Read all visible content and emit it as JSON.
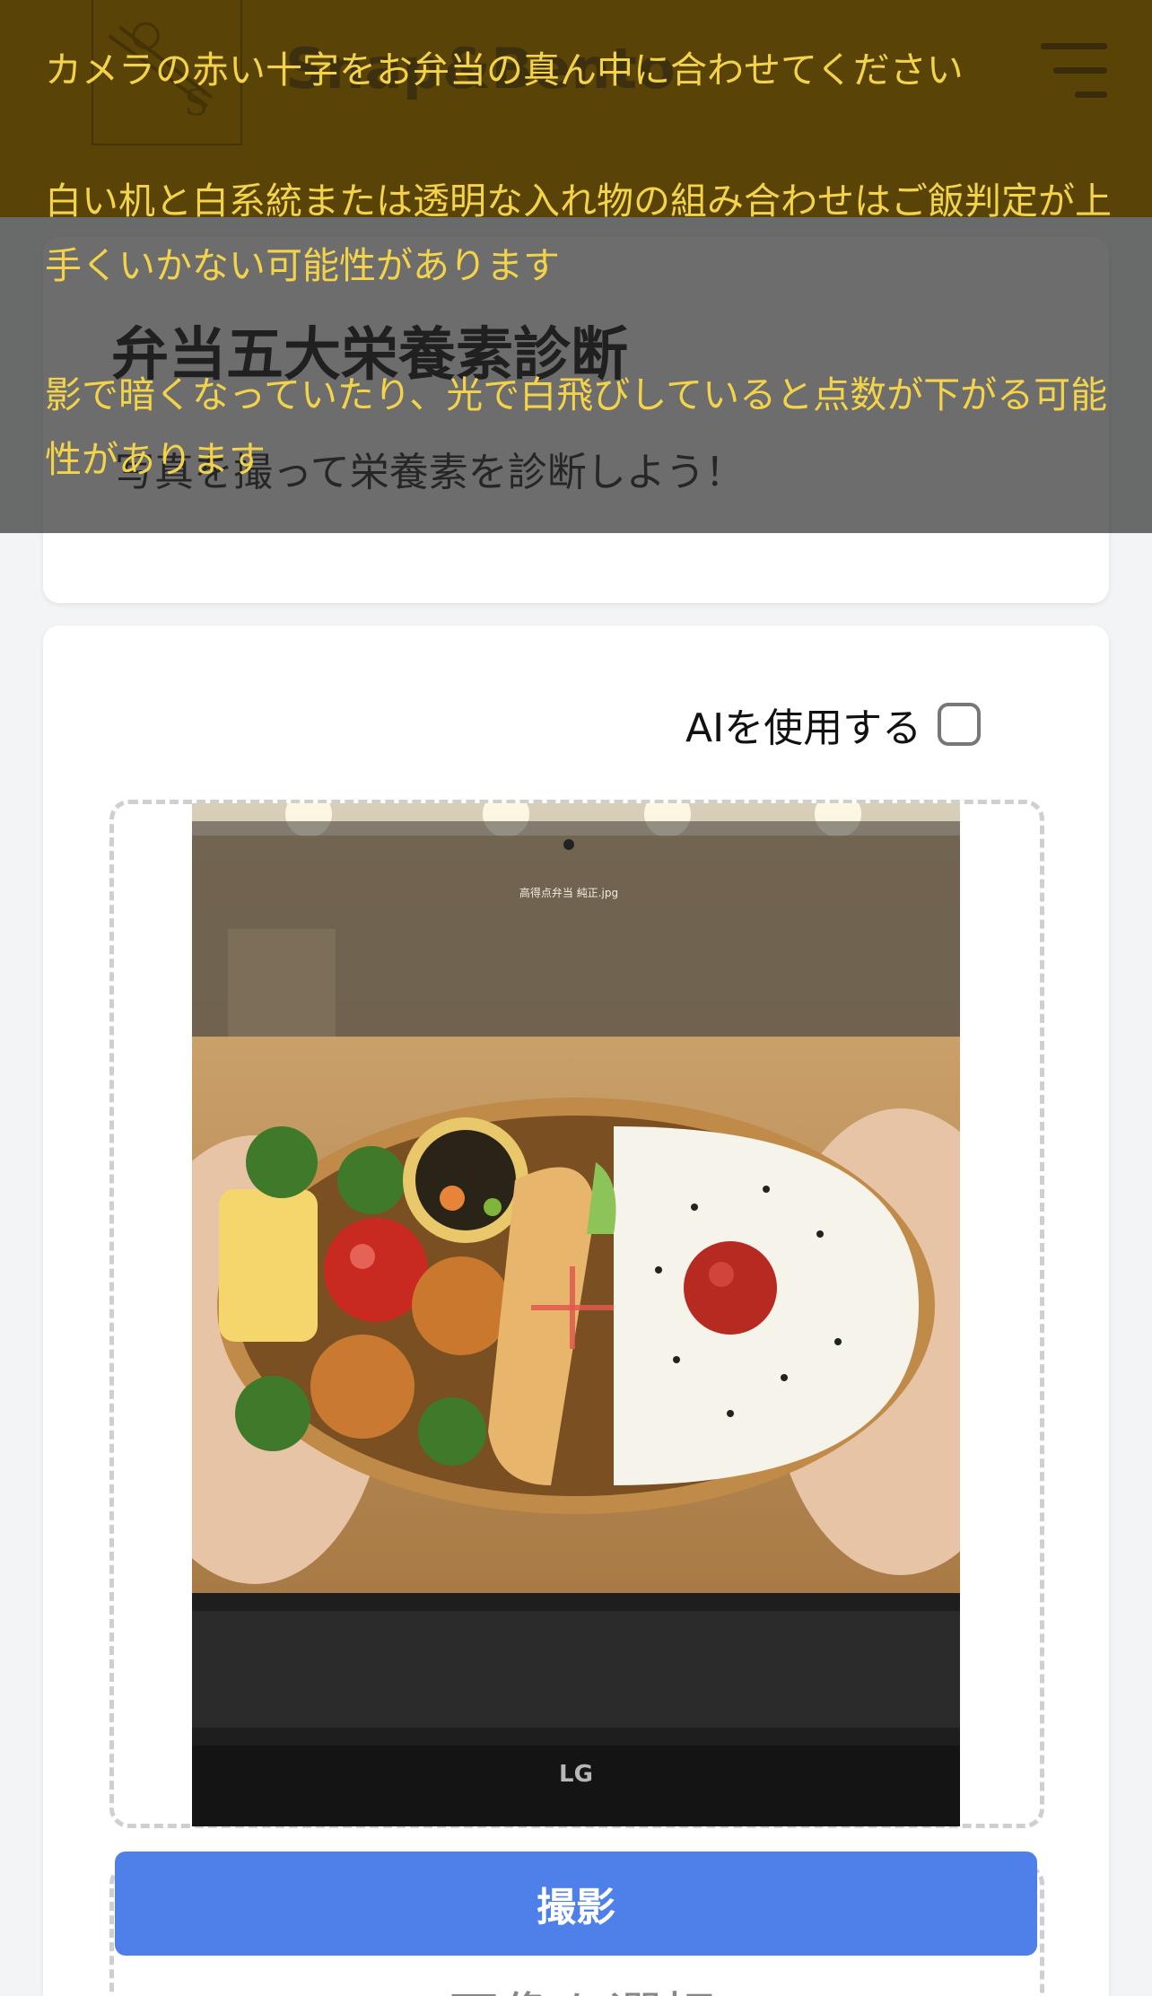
{
  "header": {
    "app_title": "Snap&Bento",
    "logo_letter": "S",
    "menu_icon": "hamburger-menu-icon",
    "background": "#5a4308"
  },
  "tips": [
    "カメラの赤い十字をお弁当の真ん中に合わせてください",
    "白い机と白系統または透明な入れ物の組み合わせはご飯判定が上手くいかない可能性があります",
    "影で暗くなっていたり、光で白飛びしていると点数が下がる可能性があります"
  ],
  "intro": {
    "title": "弁当五大栄養素診断",
    "subtitle": "写真を撮って栄養素を診断しよう！"
  },
  "camera": {
    "ai_label": "AIを使用する",
    "ai_checked": false,
    "capture_label": "撮影",
    "select_image_label": "画像を選択",
    "screen_filename": "高得点弁当 純正.jpg",
    "laptop_brand": "LG",
    "crosshair_color": "#e05a4e"
  },
  "colors": {
    "primary_button": "#4f80ea",
    "tip_text": "#f3d34a",
    "page_bg": "#f3f4f6"
  }
}
